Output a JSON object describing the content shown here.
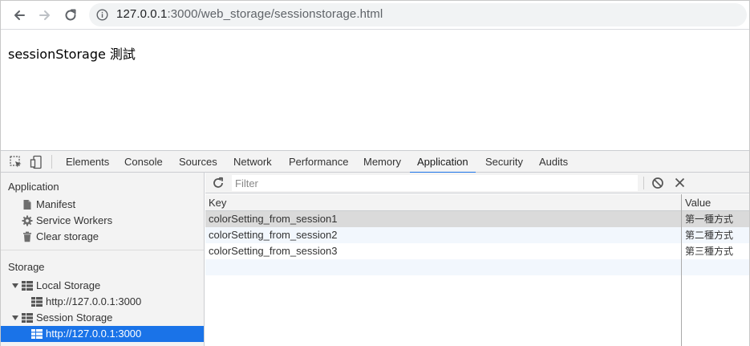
{
  "browser": {
    "url_host": "127.0.0.1",
    "url_rest": ":3000/web_storage/sessionstorage.html"
  },
  "page": {
    "heading": "sessionStorage 測試"
  },
  "devtools": {
    "tabs": [
      "Elements",
      "Console",
      "Sources",
      "Network",
      "Performance",
      "Memory",
      "Application",
      "Security",
      "Audits"
    ],
    "active_tab": "Application",
    "sidebar": {
      "application_section": "Application",
      "manifest": "Manifest",
      "service_workers": "Service Workers",
      "clear_storage": "Clear storage",
      "storage_section": "Storage",
      "local_storage": "Local Storage",
      "local_origin": "http://127.0.0.1:3000",
      "session_storage": "Session Storage",
      "session_origin": "http://127.0.0.1:3000"
    },
    "filter_placeholder": "Filter",
    "columns": {
      "key": "Key",
      "value": "Value"
    },
    "rows": [
      {
        "key": "colorSetting_from_session1",
        "value": "第一種方式"
      },
      {
        "key": "colorSetting_from_session2",
        "value": "第二種方式"
      },
      {
        "key": "colorSetting_from_session3",
        "value": "第三種方式"
      }
    ],
    "colors": {
      "accent": "#1a73e8",
      "selected_row": "#dadada",
      "alt_row": "#f2f7fd"
    }
  }
}
